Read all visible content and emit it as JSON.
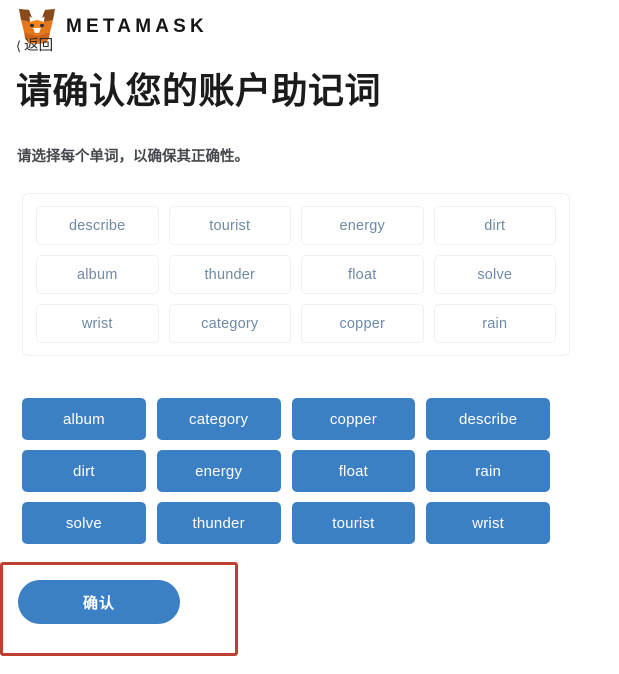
{
  "brand": {
    "wordmark": "METAMASK",
    "logo_icon": "metamask-fox-icon"
  },
  "nav": {
    "back_label": "返回",
    "back_icon": "chevron-left-icon"
  },
  "header": {
    "title": "请确认您的账户助记词",
    "subtitle": "请选择每个单词，以确保其正确性。"
  },
  "seed_panel": {
    "rows": [
      [
        "describe",
        "tourist",
        "energy",
        "dirt"
      ],
      [
        "album",
        "thunder",
        "float",
        "solve"
      ],
      [
        "wrist",
        "category",
        "copper",
        "rain"
      ]
    ]
  },
  "word_bank": {
    "rows": [
      [
        "album",
        "category",
        "copper",
        "describe"
      ],
      [
        "dirt",
        "energy",
        "float",
        "rain"
      ],
      [
        "solve",
        "thunder",
        "tourist",
        "wrist"
      ]
    ]
  },
  "actions": {
    "confirm_label": "确认"
  },
  "colors": {
    "accent_blue": "#3b7fc4",
    "chip_text": "#6e8aa6",
    "annotation_red": "#bf4030",
    "panel_border": "#efefef"
  }
}
